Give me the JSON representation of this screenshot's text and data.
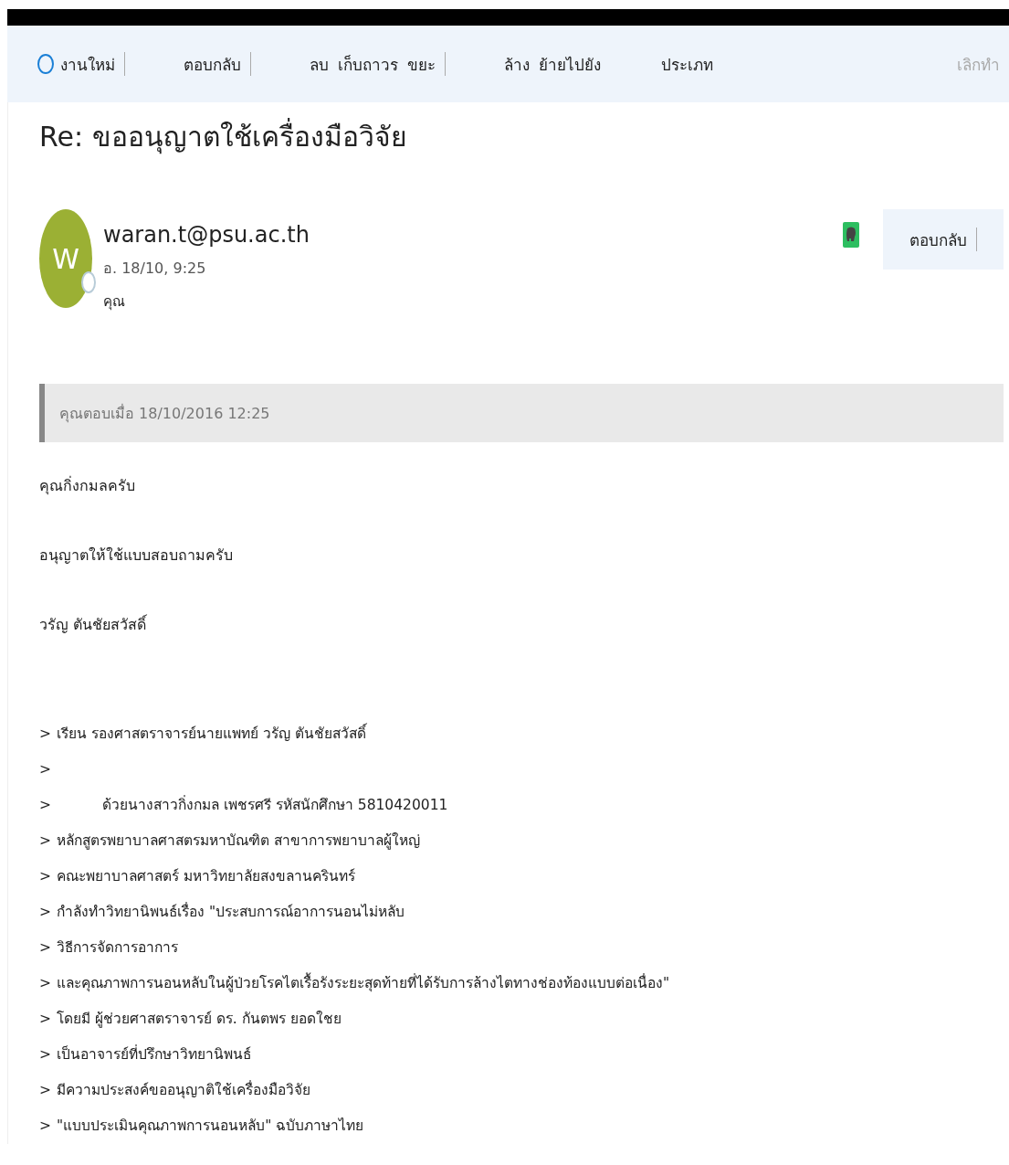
{
  "toolbar": [
    {
      "label": "งานใหม่",
      "kind": "new",
      "disabled": false,
      "divider_after": true
    },
    {
      "label": "ตอบกลับ",
      "disabled": false,
      "divider_after": true
    },
    {
      "label": "ลบ",
      "disabled": false,
      "divider_after": false
    },
    {
      "label": "เก็บถาวร",
      "disabled": false,
      "divider_after": false
    },
    {
      "label": "ขยะ",
      "disabled": false,
      "divider_after": true
    },
    {
      "label": "ล้าง",
      "disabled": false,
      "divider_after": false
    },
    {
      "label": "ย้ายไปยัง",
      "disabled": false,
      "divider_after": false
    },
    {
      "label": "ประเภท",
      "disabled": false,
      "divider_after": false
    },
    {
      "label": "เลิกทำ",
      "disabled": true,
      "divider_after": false
    }
  ],
  "subject": "Re: ขออนุญาตใช้เครื่องมือวิจัย",
  "sender": {
    "initial": "W",
    "email": "waran.t@psu.ac.th",
    "date": "อ. 18/10, 9:25",
    "to": "คุณ",
    "color": "#9bb034"
  },
  "reply_button": {
    "label": "ตอบกลับ"
  },
  "replied_banner": "คุณตอบเมื่อ 18/10/2016 12:25",
  "body": [
    "คุณกิ่งกมลครับ",
    "อนุญาตให้ใช้แบบสอบถามครับ",
    "วรัญ ตันชัยสวัสดิ์"
  ],
  "quote_lines": [
    {
      "marker": ">",
      "text": "เรียน รองศาสตราจารย์นายแพทย์ วรัญ  ตันชัยสวัสดิ์",
      "indented": false
    },
    {
      "marker": ">"
    },
    {
      "marker": ">",
      "text": "ด้วยนางสาวกิ่งกมล เพชรศรี รหัสนักศึกษา 5810420011",
      "indented": true
    },
    {
      "marker": ">",
      "text": "หลักสูตรพยาบาลศาสตรมหาบัณฑิต สาขาการพยาบาลผู้ใหญ่",
      "indented": false
    },
    {
      "marker": ">",
      "text": "คณะพยาบาลศาสตร์ มหาวิทยาลัยสงขลานครินทร์",
      "indented": false
    },
    {
      "marker": ">",
      "text": "กำลังทำวิทยานิพนธ์เรื่อง \"ประสบการณ์อาการนอนไม่หลับ",
      "indented": false
    },
    {
      "marker": ">",
      "text": "วิธีการจัดการอาการ",
      "indented": false
    },
    {
      "marker": ">",
      "text": "และคุณภาพการนอนหลับในผู้ป่วยโรคไตเรื้อรังระยะสุดท้ายที่ได้รับการล้างไตทางช่องท้องแบบต่อเนื่อง\"",
      "indented": false
    },
    {
      "marker": ">",
      "text": "โดยมี ผู้ช่วยศาสตราจารย์ ดร. กันตพร ยอดใชย",
      "indented": false
    },
    {
      "marker": ">",
      "text": "เป็นอาจารย์ที่ปรึกษาวิทยานิพนธ์",
      "indented": false
    },
    {
      "marker": ">",
      "text": "มีความประสงค์ขออนุญาติใช้เครื่องมือวิจัย",
      "indented": false
    },
    {
      "marker": ">",
      "text": "\"แบบประเมินคุณภาพการนอนหลับ\" ฉบับภาษาไทย",
      "indented": false
    }
  ]
}
